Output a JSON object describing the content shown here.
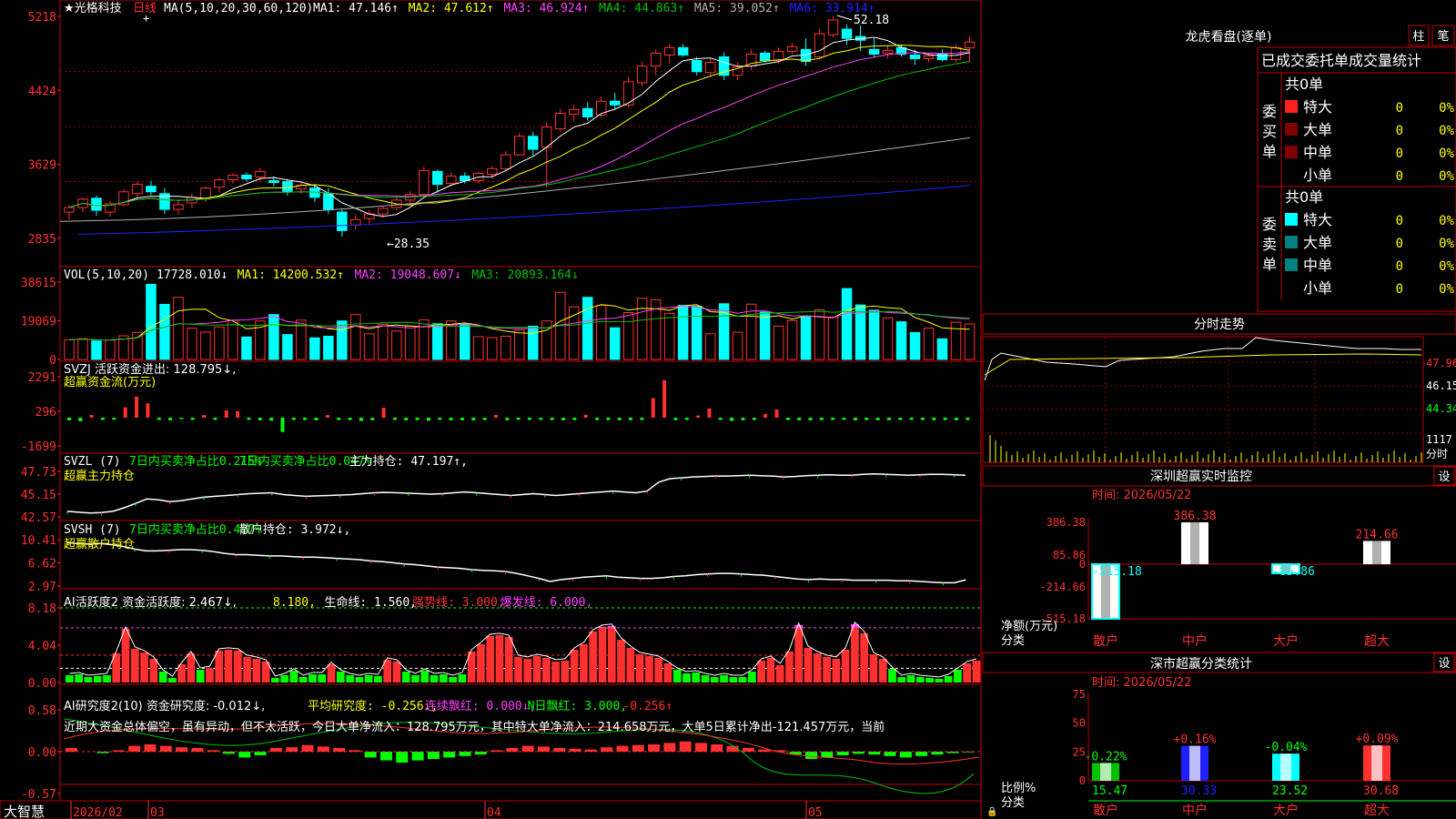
{
  "colors": {
    "up": "#ff3030",
    "down": "#00ffff",
    "grid": "#8b0000",
    "border": "#c00000",
    "axis_text": "#ff3030",
    "white": "#ffffff",
    "yellow": "#ffff00",
    "magenta": "#ff40ff",
    "green": "#00c000",
    "gray": "#b0b0b0",
    "blue": "#2020ff",
    "lime": "#00ff00"
  },
  "main": {
    "title_prefix": "★光格科技",
    "period": "日线",
    "ma_def": "MA(5,10,20,30,60,120)",
    "ma_labels": [
      {
        "text": "MA1: 47.146↑",
        "color": "#ffffff"
      },
      {
        "text": "MA2: 47.612↑",
        "color": "#ffff00"
      },
      {
        "text": "MA3: 46.924↑",
        "color": "#ff40ff"
      },
      {
        "text": "MA4: 44.863↑",
        "color": "#00c000"
      },
      {
        "text": "MA5: 39.052↑",
        "color": "#b0b0b0"
      },
      {
        "text": "MA6: 33.914↑",
        "color": "#2020ff"
      }
    ],
    "y_ticks": [
      "5218",
      "4424",
      "3629",
      "2835"
    ],
    "high_label": "52.18",
    "low_label": "28.35",
    "candles": [
      {
        "o": 31.0,
        "h": 31.8,
        "l": 30.2,
        "c": 31.5
      },
      {
        "o": 31.5,
        "h": 32.6,
        "l": 31.0,
        "c": 32.4
      },
      {
        "o": 32.5,
        "h": 32.8,
        "l": 30.6,
        "c": 31.2
      },
      {
        "o": 31.0,
        "h": 32.2,
        "l": 30.5,
        "c": 31.9
      },
      {
        "o": 31.8,
        "h": 33.5,
        "l": 31.6,
        "c": 33.2
      },
      {
        "o": 33.0,
        "h": 34.3,
        "l": 32.6,
        "c": 34.0
      },
      {
        "o": 33.8,
        "h": 34.4,
        "l": 32.8,
        "c": 33.2
      },
      {
        "o": 33.0,
        "h": 33.6,
        "l": 30.8,
        "c": 31.3
      },
      {
        "o": 31.3,
        "h": 32.4,
        "l": 30.7,
        "c": 31.8
      },
      {
        "o": 32.0,
        "h": 33.0,
        "l": 31.4,
        "c": 32.6
      },
      {
        "o": 32.4,
        "h": 33.8,
        "l": 32.1,
        "c": 33.6
      },
      {
        "o": 33.7,
        "h": 34.7,
        "l": 33.1,
        "c": 34.5
      },
      {
        "o": 34.5,
        "h": 35.2,
        "l": 34.1,
        "c": 35.0
      },
      {
        "o": 35.0,
        "h": 35.3,
        "l": 34.3,
        "c": 34.6
      },
      {
        "o": 34.8,
        "h": 35.8,
        "l": 34.4,
        "c": 35.4
      },
      {
        "o": 34.4,
        "h": 34.9,
        "l": 33.8,
        "c": 34.2
      },
      {
        "o": 34.3,
        "h": 34.6,
        "l": 32.8,
        "c": 33.2
      },
      {
        "o": 33.5,
        "h": 34.2,
        "l": 33.0,
        "c": 33.9
      },
      {
        "o": 33.6,
        "h": 33.9,
        "l": 32.1,
        "c": 32.6
      },
      {
        "o": 33.0,
        "h": 33.6,
        "l": 30.8,
        "c": 31.3
      },
      {
        "o": 31.0,
        "h": 31.3,
        "l": 28.35,
        "c": 29.0
      },
      {
        "o": 29.6,
        "h": 30.7,
        "l": 29.1,
        "c": 30.2
      },
      {
        "o": 30.3,
        "h": 31.2,
        "l": 29.8,
        "c": 30.8
      },
      {
        "o": 30.8,
        "h": 31.6,
        "l": 30.4,
        "c": 31.4
      },
      {
        "o": 31.5,
        "h": 32.8,
        "l": 31.2,
        "c": 32.3
      },
      {
        "o": 32.3,
        "h": 33.3,
        "l": 31.8,
        "c": 32.9
      },
      {
        "o": 32.9,
        "h": 35.9,
        "l": 32.7,
        "c": 35.5
      },
      {
        "o": 35.4,
        "h": 35.6,
        "l": 33.1,
        "c": 34.0
      },
      {
        "o": 34.1,
        "h": 35.3,
        "l": 33.8,
        "c": 34.9
      },
      {
        "o": 34.9,
        "h": 35.3,
        "l": 34.1,
        "c": 34.4
      },
      {
        "o": 34.4,
        "h": 35.4,
        "l": 34.1,
        "c": 35.2
      },
      {
        "o": 35.1,
        "h": 36.0,
        "l": 34.6,
        "c": 35.7
      },
      {
        "o": 35.7,
        "h": 37.6,
        "l": 35.4,
        "c": 37.2
      },
      {
        "o": 37.2,
        "h": 39.6,
        "l": 37.1,
        "c": 39.2
      },
      {
        "o": 39.2,
        "h": 39.7,
        "l": 37.1,
        "c": 37.8
      },
      {
        "o": 38.0,
        "h": 40.7,
        "l": 33.7,
        "c": 40.2
      },
      {
        "o": 40.0,
        "h": 42.2,
        "l": 39.8,
        "c": 41.7
      },
      {
        "o": 41.6,
        "h": 42.6,
        "l": 40.8,
        "c": 42.1
      },
      {
        "o": 42.2,
        "h": 42.9,
        "l": 40.9,
        "c": 41.3
      },
      {
        "o": 41.5,
        "h": 43.5,
        "l": 41.2,
        "c": 43.0
      },
      {
        "o": 43.0,
        "h": 43.9,
        "l": 42.1,
        "c": 42.6
      },
      {
        "o": 42.6,
        "h": 45.6,
        "l": 42.3,
        "c": 45.1
      },
      {
        "o": 45.0,
        "h": 47.3,
        "l": 44.6,
        "c": 46.8
      },
      {
        "o": 46.8,
        "h": 48.6,
        "l": 45.8,
        "c": 48.2
      },
      {
        "o": 48.0,
        "h": 49.2,
        "l": 47.1,
        "c": 48.8
      },
      {
        "o": 48.8,
        "h": 49.2,
        "l": 47.8,
        "c": 48.0
      },
      {
        "o": 47.4,
        "h": 47.8,
        "l": 45.8,
        "c": 46.2
      },
      {
        "o": 46.1,
        "h": 47.7,
        "l": 45.7,
        "c": 47.2
      },
      {
        "o": 47.8,
        "h": 48.3,
        "l": 45.3,
        "c": 45.8
      },
      {
        "o": 45.8,
        "h": 47.2,
        "l": 45.3,
        "c": 46.7
      },
      {
        "o": 46.8,
        "h": 48.6,
        "l": 46.4,
        "c": 48.1
      },
      {
        "o": 48.2,
        "h": 48.5,
        "l": 47.2,
        "c": 47.4
      },
      {
        "o": 47.4,
        "h": 48.8,
        "l": 47.1,
        "c": 48.4
      },
      {
        "o": 48.4,
        "h": 49.3,
        "l": 48.1,
        "c": 48.9
      },
      {
        "o": 48.6,
        "h": 49.8,
        "l": 46.8,
        "c": 47.3
      },
      {
        "o": 47.8,
        "h": 50.8,
        "l": 47.5,
        "c": 50.3
      },
      {
        "o": 50.2,
        "h": 52.18,
        "l": 49.9,
        "c": 51.8
      },
      {
        "o": 50.8,
        "h": 51.3,
        "l": 49.1,
        "c": 49.8
      },
      {
        "o": 50.0,
        "h": 51.2,
        "l": 48.4,
        "c": 49.6
      },
      {
        "o": 48.6,
        "h": 49.8,
        "l": 47.8,
        "c": 48.1
      },
      {
        "o": 48.2,
        "h": 49.0,
        "l": 47.6,
        "c": 48.5
      },
      {
        "o": 48.8,
        "h": 49.1,
        "l": 47.8,
        "c": 48.1
      },
      {
        "o": 48.0,
        "h": 48.6,
        "l": 46.9,
        "c": 47.6
      },
      {
        "o": 47.6,
        "h": 48.2,
        "l": 47.2,
        "c": 47.9
      },
      {
        "o": 48.1,
        "h": 48.6,
        "l": 47.3,
        "c": 47.5
      },
      {
        "o": 47.5,
        "h": 49.2,
        "l": 47.2,
        "c": 48.8
      },
      {
        "o": 48.8,
        "h": 50.0,
        "l": 47.2,
        "c": 49.4
      }
    ]
  },
  "vol": {
    "title": "VOL(5,10,20)",
    "labels": [
      {
        "text": "17728.010↓",
        "color": "#ffffff"
      },
      {
        "text": "MA1: 14200.532↑",
        "color": "#ffff00"
      },
      {
        "text": "MA2: 19048.607↓",
        "color": "#ff40ff"
      },
      {
        "text": "MA3: 20893.164↓",
        "color": "#00c000"
      }
    ],
    "y_ticks": [
      "38615",
      "19069",
      "0"
    ],
    "values": [
      9800,
      10400,
      9200,
      9600,
      11800,
      13500,
      37500,
      27500,
      31000,
      15600,
      13700,
      16200,
      19600,
      11200,
      19200,
      22400,
      12400,
      19600,
      10800,
      11600,
      19200,
      22400,
      12800,
      17600,
      14200,
      16600,
      19800,
      17800,
      19200,
      17600,
      11400,
      10900,
      11600,
      14600,
      16600,
      19200,
      33500,
      26200,
      31000,
      27000,
      15800,
      23400,
      30600,
      29800,
      23000,
      27000,
      26600,
      12800,
      27800,
      13600,
      27600,
      23600,
      16600,
      19400,
      21700,
      24800,
      21200,
      35400,
      27200,
      24600,
      20800,
      18800,
      13400,
      15600,
      10300,
      18600,
      17728
    ]
  },
  "svzj": {
    "title": "SVZJ  活跃资金进出: 128.795↓,",
    "subtitle": "超赢资金流(万元)",
    "y_ticks": [
      "2291",
      "296",
      "-1699"
    ],
    "values": [
      -150,
      -200,
      150,
      -120,
      -110,
      580,
      1180,
      800,
      -120,
      -150,
      -80,
      -120,
      150,
      -120,
      410,
      360,
      -120,
      -150,
      -170,
      -800,
      -120,
      -130,
      -150,
      150,
      -130,
      -130,
      -180,
      -140,
      560,
      -120,
      -150,
      -130,
      -170,
      -120,
      -150,
      -140,
      -150,
      -130,
      150,
      -140,
      -110,
      -120,
      -120,
      -130,
      -140,
      -130,
      160,
      -130,
      -130,
      -140,
      -140,
      -130,
      1100,
      2100,
      -140,
      -120,
      120,
      520,
      -120,
      -180,
      -140,
      -130,
      210,
      460,
      -130,
      -140,
      -150,
      -130,
      -120,
      -120,
      -150,
      -130,
      -140,
      -140,
      -130,
      -120,
      -130,
      -140,
      -130,
      -140,
      -130
    ]
  },
  "svzl": {
    "title": "SVZL (7)",
    "labels": [
      {
        "text": "7日内买卖净占比0.215%",
        "color": "#00ff00"
      },
      {
        "text": "7日内买卖净占比0.047%",
        "color": "#00ff00"
      },
      {
        "text": "主力持仓: 47.197↑,",
        "color": "#ffffff"
      }
    ],
    "subtitle": "超赢主力持仓",
    "y_ticks": [
      "47.73",
      "45.15",
      "42.57"
    ],
    "values": [
      43.2,
      43.1,
      43.0,
      43.05,
      43.2,
      43.6,
      44.1,
      44.6,
      44.5,
      44.3,
      44.4,
      44.6,
      44.8,
      44.9,
      45.0,
      45.1,
      45.2,
      45.25,
      45.3,
      45.1,
      45.0,
      44.9,
      44.95,
      45.0,
      45.05,
      45.1,
      45.2,
      45.3,
      45.35,
      45.3,
      45.25,
      45.2,
      45.15,
      45.2,
      45.3,
      45.4,
      45.3,
      45.2,
      45.1,
      45.0,
      45.1,
      45.2,
      45.1,
      45.0,
      45.1,
      45.2,
      45.3,
      45.4,
      45.5,
      45.4,
      45.3,
      45.5,
      46.5,
      46.9,
      47.0,
      47.1,
      47.15,
      47.2,
      47.2,
      47.25,
      47.3,
      47.25,
      47.2,
      47.1,
      47.15,
      47.25,
      47.3,
      47.35,
      47.3,
      47.3,
      47.4,
      47.45,
      47.4,
      47.35,
      47.3,
      47.35,
      47.4,
      47.4,
      47.35,
      47.3
    ]
  },
  "svsh": {
    "title": "SVSH (7)",
    "labels": [
      {
        "text": "7日内买卖净占比0.497%",
        "color": "#00ff00"
      },
      {
        "text": "散户持仓: 3.972↓,",
        "color": "#ffffff"
      }
    ],
    "subtitle": "超赢散户持仓",
    "y_ticks": [
      "10.41",
      "6.62",
      "2.97"
    ],
    "values": [
      9.9,
      9.8,
      9.7,
      9.8,
      9.6,
      9.3,
      8.9,
      8.6,
      8.6,
      8.7,
      8.8,
      8.8,
      8.7,
      8.5,
      8.2,
      8.0,
      8.0,
      7.9,
      7.8,
      7.8,
      7.7,
      7.6,
      7.6,
      7.5,
      7.4,
      7.3,
      7.2,
      7.0,
      6.9,
      6.7,
      6.5,
      6.4,
      6.2,
      6.0,
      5.9,
      5.8,
      5.6,
      5.5,
      5.4,
      5.3,
      5.0,
      4.6,
      4.2,
      3.7,
      4.0,
      4.2,
      4.4,
      4.5,
      4.6,
      4.4,
      4.3,
      4.2,
      4.2,
      4.3,
      4.5,
      4.6,
      4.8,
      4.9,
      5.0,
      5.0,
      4.9,
      4.8,
      4.7,
      4.5,
      4.3,
      4.1,
      4.0,
      4.1,
      4.0,
      4.0,
      3.9,
      3.9,
      3.9,
      3.9,
      3.8,
      3.8,
      3.7,
      3.6,
      3.5,
      3.5,
      3.97
    ]
  },
  "ai1": {
    "title": "AI活跃度2 资金活跃度: 2.467↓,",
    "labels": [
      {
        "text": "8.180,",
        "color": "#ffff00"
      },
      {
        "text": "生命线: 1.560,",
        "color": "#ffffff"
      },
      {
        "text": "强势线: 3.000,",
        "color": "#ff3030"
      },
      {
        "text": "爆发线: 6.000,",
        "color": "#ff40ff"
      }
    ],
    "y_ticks": [
      "8.18",
      "4.04",
      "0.00"
    ],
    "values": [
      0.8,
      0.9,
      0.6,
      0.7,
      0.8,
      3.2,
      5.9,
      3.7,
      3.3,
      2.6,
      1.2,
      0.5,
      2.0,
      3.2,
      1.4,
      1.6,
      3.5,
      3.6,
      3.5,
      2.8,
      2.6,
      2.3,
      0.5,
      0.8,
      1.3,
      0.6,
      0.9,
      0.9,
      2.0,
      1.2,
      0.8,
      0.6,
      0.8,
      0.7,
      2.5,
      2.3,
      1.2,
      0.8,
      1.3,
      0.8,
      0.9,
      0.6,
      0.9,
      3.4,
      4.2,
      5.1,
      5.2,
      5.0,
      2.8,
      2.6,
      2.9,
      2.7,
      2.3,
      2.4,
      3.6,
      4.2,
      5.6,
      6.1,
      6.2,
      4.7,
      3.8,
      3.1,
      2.9,
      2.7,
      2.1,
      1.4,
      1.0,
      1.1,
      0.8,
      0.6,
      0.8,
      0.6,
      0.6,
      1.2,
      2.4,
      2.7,
      1.9,
      3.4,
      6.3,
      3.8,
      3.2,
      2.8,
      2.6,
      3.6,
      6.4,
      5.4,
      3.1,
      2.6,
      1.5,
      0.6,
      0.8,
      0.6,
      0.5,
      0.4,
      0.7,
      1.4,
      2.1,
      2.4
    ]
  },
  "ai2": {
    "title": "AI研究度2(10) 资金研究度: -0.012↓,",
    "labels": [
      {
        "text": "平均研究度: -0.256↓,",
        "color": "#ffff00"
      },
      {
        "text": "连续飘红: 0.000↓,",
        "color": "#ff40ff"
      },
      {
        "text": "N日飘红: 3.000,",
        "color": "#00ff00"
      },
      {
        "text": "-0.256↑",
        "color": "#ff3030"
      }
    ],
    "note": "近期大资金总体偏空，虽有异动，但不太活跃，今日大单净流入：128.795万元，其中特大单净流入：214.658万元，大单5日累计净出-121.457万元，当前",
    "y_ticks": [
      "0.58",
      "0.00",
      "-0.57"
    ],
    "values": [
      0.05,
      0.0,
      -0.02,
      0.02,
      0.08,
      0.1,
      0.08,
      0.06,
      0.05,
      0.02,
      -0.03,
      -0.08,
      -0.05,
      0.05,
      0.06,
      0.09,
      0.07,
      0.05,
      0.02,
      -0.08,
      -0.12,
      -0.15,
      -0.12,
      -0.1,
      -0.08,
      -0.06,
      -0.04,
      0.02,
      0.05,
      0.08,
      0.07,
      0.05,
      0.04,
      0.03,
      0.06,
      0.08,
      0.09,
      0.1,
      0.12,
      0.14,
      0.12,
      0.1,
      0.08,
      0.05,
      0.03,
      0.02,
      -0.04,
      -0.1,
      -0.08,
      -0.05,
      -0.03,
      -0.04,
      -0.06,
      -0.08,
      -0.06,
      -0.04,
      -0.02,
      -0.01
    ]
  },
  "date_bar": {
    "brand": "大智慧",
    "ticks": [
      "2026/02",
      "03",
      "04",
      "05"
    ]
  },
  "right": {
    "top_title": "龙虎看盘(逐单)",
    "btn_zhu": "柱",
    "btn_bi": "笔",
    "table_title": "已成交委托单成交量统计",
    "buy_header": "共0单",
    "sell_header": "共0单",
    "buy_side": "委买单",
    "sell_side": "委卖单",
    "rows": [
      {
        "name": "特大",
        "count": "0",
        "pct": "0%"
      },
      {
        "name": "大单",
        "count": "0",
        "pct": "0%"
      },
      {
        "name": "中单",
        "count": "0",
        "pct": "0%"
      },
      {
        "name": "小单",
        "count": "0",
        "pct": "0%"
      }
    ],
    "intraday_title": "分时走势",
    "intraday_ticks": [
      "47.96",
      "46.15",
      "44.34",
      "1117",
      "分时"
    ],
    "sz_title": "深圳超赢实时监控",
    "sz_time": "时间: 2026/05/22",
    "sz_y_ticks": [
      "386.38",
      "85.86",
      "0",
      "-214.66",
      "-515.18"
    ],
    "sz_ylabel": "净额(万元)",
    "sz_xlabel": "分类",
    "sz_bars": [
      {
        "name": "散户",
        "value": -515.18,
        "label": "-515.18"
      },
      {
        "name": "中户",
        "value": 386.38,
        "label": "386.38"
      },
      {
        "name": "大户",
        "value": -85.86,
        "label": "-85.86"
      },
      {
        "name": "超大",
        "value": 214.66,
        "label": "214.66"
      }
    ],
    "ss_title": "深市超赢分类统计",
    "ss_time": "时间: 2026/05/22",
    "ss_y_ticks": [
      "75",
      "50",
      "25",
      "0"
    ],
    "ss_ylabel": "比例%",
    "ss_xlabel": "分类",
    "ss_bars": [
      {
        "name": "散户",
        "value": 15.47,
        "change": "-0.22%",
        "color": "#00c000"
      },
      {
        "name": "中户",
        "value": 30.33,
        "change": "+0.16%",
        "color": "#2020ff"
      },
      {
        "name": "大户",
        "value": 23.52,
        "change": "-0.04%",
        "color": "#00ffff"
      },
      {
        "name": "超大",
        "value": 30.68,
        "change": "+0.09%",
        "color": "#ff3030"
      }
    ],
    "settings": "设"
  }
}
